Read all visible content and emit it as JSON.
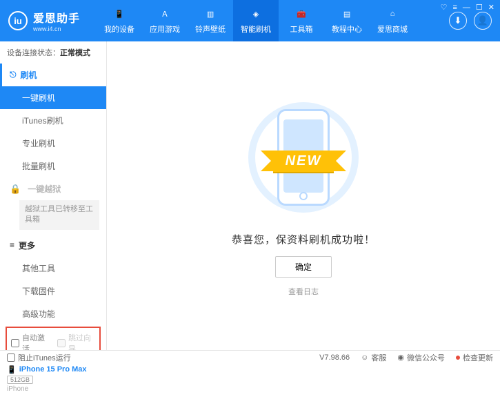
{
  "app": {
    "name": "爱思助手",
    "url": "www.i4.cn"
  },
  "nav": {
    "items": [
      {
        "label": "我的设备"
      },
      {
        "label": "应用游戏"
      },
      {
        "label": "铃声壁纸"
      },
      {
        "label": "智能刷机"
      },
      {
        "label": "工具箱"
      },
      {
        "label": "教程中心"
      },
      {
        "label": "爱思商城"
      }
    ]
  },
  "status": {
    "label": "设备连接状态：",
    "value": "正常模式"
  },
  "sidebar": {
    "flash": {
      "title": "刷机",
      "items": [
        "一键刷机",
        "iTunes刷机",
        "专业刷机",
        "批量刷机"
      ]
    },
    "jailbreak": {
      "title": "一键越狱",
      "note": "越狱工具已转移至工具箱"
    },
    "more": {
      "title": "更多",
      "items": [
        "其他工具",
        "下载固件",
        "高级功能"
      ]
    }
  },
  "checks": {
    "auto_activate": "自动激活",
    "skip_guide": "跳过向导"
  },
  "device": {
    "name": "iPhone 15 Pro Max",
    "storage": "512GB",
    "type": "iPhone"
  },
  "main": {
    "ribbon": "NEW",
    "msg": "恭喜您，保资料刷机成功啦！",
    "ok": "确定",
    "log": "查看日志"
  },
  "footer": {
    "block_itunes": "阻止iTunes运行",
    "version": "V7.98.66",
    "service": "客服",
    "wechat": "微信公众号",
    "update": "检查更新"
  }
}
